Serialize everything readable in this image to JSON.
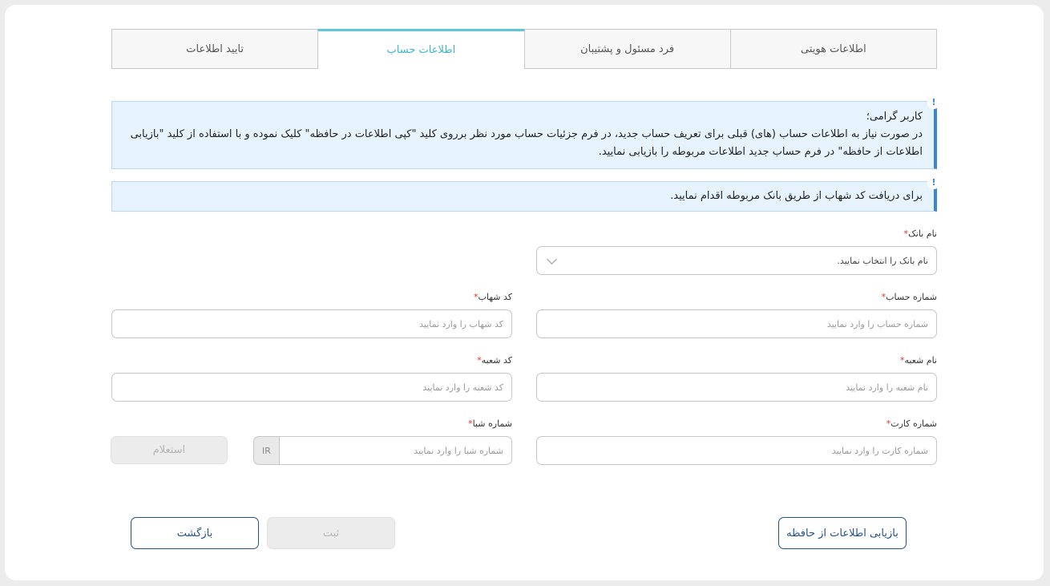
{
  "tabs": [
    {
      "label": "اطلاعات هویتی",
      "active": false
    },
    {
      "label": "فرد مسئول و پشتیبان",
      "active": false
    },
    {
      "label": "اطلاعات حساب",
      "active": true
    },
    {
      "label": "تایید اطلاعات",
      "active": false
    }
  ],
  "alerts": {
    "info_icon": "!",
    "copy_info": {
      "greeting": "کاربر گرامی؛",
      "line1": "در صورت نیاز به اطلاعات حساب (های) قبلی برای تعریف حساب جدید، در فرم جزئیات حساب مورد نظر برروی کلید \"کپی اطلاعات در حافظه\" کلیک نموده و با استفاده از کلید \"بازیابی",
      "line2": "اطلاعات از حافظه\" در فرم حساب جدید اطلاعات مربوطه را بازیابی نمایید."
    },
    "shahab_info": "برای دریافت کد شهاب از طریق بانک مربوطه اقدام نمایید."
  },
  "form": {
    "required_mark": "*",
    "bank_name": {
      "label": "نام بانک",
      "value": "نام بانک را انتخاب نمایید."
    },
    "account_number": {
      "label": "شماره حساب",
      "placeholder": "شماره حساب را وارد نمایید"
    },
    "shahab_code": {
      "label": "کد شهاب",
      "placeholder": "کد شهاب را وارد نمایید"
    },
    "branch_name": {
      "label": "نام شعبه",
      "placeholder": "نام شعبه را وارد نمایید"
    },
    "branch_code": {
      "label": "کد شعبه",
      "placeholder": "کد شعبه را وارد نمایید"
    },
    "card_number": {
      "label": "شماره کارت",
      "placeholder": "شماره کارت را وارد نمایید"
    },
    "sheba_number": {
      "label": "شماره شبا",
      "placeholder": "شماره شبا را وارد نمایید",
      "prefix": "IR"
    },
    "inquiry_button": "استعلام"
  },
  "actions": {
    "restore_button": "بازیابی اطلاعات از حافظه",
    "submit_button": "ثبت",
    "back_button": "بازگشت"
  },
  "colors": {
    "active_tab": "#3fb4c9",
    "alert_bg": "#e6f3fd",
    "alert_border": "#3a86d4",
    "primary_outline": "#24528a",
    "required": "#e03030"
  }
}
